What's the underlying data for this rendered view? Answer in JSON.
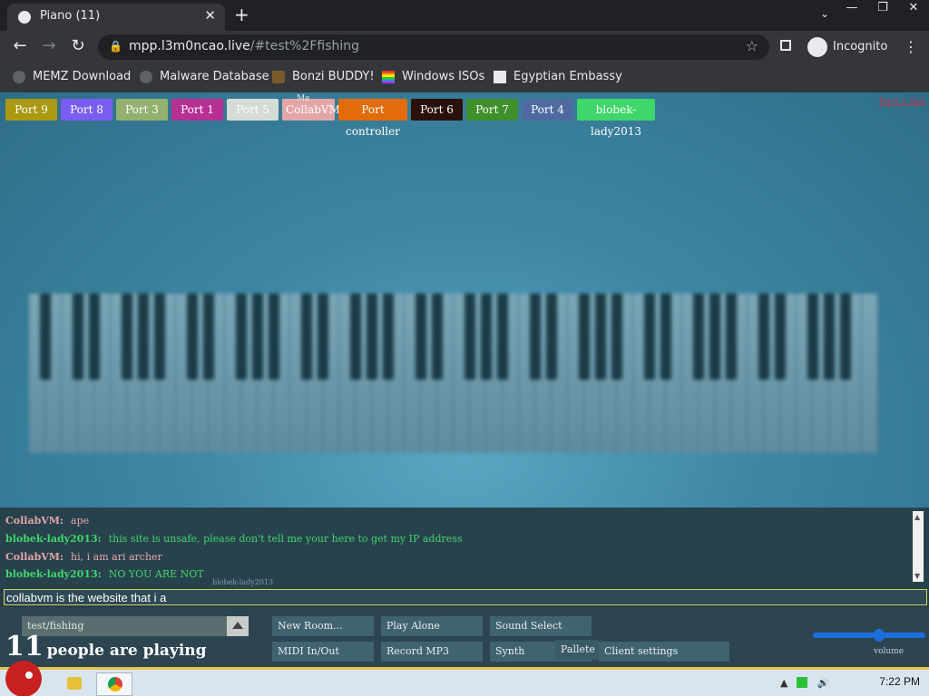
{
  "browser": {
    "tab_title": "Piano (11)",
    "tab_close": "✕",
    "new_tab": "+",
    "tab_menu": "⌄",
    "window_controls": [
      "—",
      "❐",
      "✕"
    ],
    "url_host": "mpp.l3m0ncao.live",
    "url_path": "/#test%2Ffishing",
    "incognito_label": "Incognito",
    "menu": "⋮",
    "bookmarks": [
      {
        "label": "MEMZ Download"
      },
      {
        "label": "Malware Database"
      },
      {
        "label": "Bonzi BUDDY!"
      },
      {
        "label": "Windows ISOs"
      },
      {
        "label": "Egyptian Embassy"
      }
    ]
  },
  "ports": [
    {
      "label": "Port 9",
      "bg": "#a99a12",
      "fg": "#ffffff"
    },
    {
      "label": "Port 8",
      "bg": "#7a5cf0",
      "fg": "#ffffff"
    },
    {
      "label": "Port 3",
      "bg": "#93b06e",
      "fg": "#ffffff"
    },
    {
      "label": "Port 1",
      "bg": "#b62f94",
      "fg": "#ffffff"
    },
    {
      "label": "Port 5",
      "bg": "#d5dcd5",
      "fg": "#ffffff"
    },
    {
      "label": "CollabVM",
      "bg": "#e3a6a6",
      "fg": "#ffffff",
      "tag": "Me"
    },
    {
      "label": "Port controller",
      "bg": "#e36c0a",
      "fg": "#ffffff"
    },
    {
      "label": "Port 6",
      "bg": "#2a120a",
      "fg": "#ffffff"
    },
    {
      "label": "Port 7",
      "bg": "#3f8f2c",
      "fg": "#ffffff"
    },
    {
      "label": "Port 4",
      "bg": "#4f6aa0",
      "fg": "#ffffff"
    },
    {
      "label": "blobek-lady2013",
      "bg": "#3fd66a",
      "fg": "#ffffff"
    }
  ],
  "side_link": "Port 1 Set",
  "chat": {
    "messages": [
      {
        "name": "CollabVM:",
        "text": "ape",
        "color": "#e3a6a6"
      },
      {
        "name": "blobek-lady2013:",
        "text": "this site is unsafe, please don't tell me your here to get my IP address",
        "color": "#3fd66a"
      },
      {
        "name": "CollabVM:",
        "text": "hi, i am ari archer",
        "color": "#e3a6a6"
      },
      {
        "name": "blobek-lady2013:",
        "text": "NO YOU ARE NOT",
        "color": "#3fd66a"
      }
    ],
    "typing_tag": "blobek-lady2013",
    "input_value": "collabvm is the website that i a"
  },
  "controls": {
    "room": "test/fishing",
    "people_count": "11",
    "people_label": "people are playing",
    "buttons": {
      "new_room": "New Room...",
      "play_alone": "Play Alone",
      "sound_select": "Sound Select",
      "midi": "MIDI In/Out",
      "record": "Record MP3",
      "synth": "Synth",
      "pallete": "Pallete",
      "client_settings": "Client settings"
    },
    "volume_label": "volume",
    "volume_level": 0.6
  },
  "taskbar": {
    "time": "7:22 PM"
  }
}
